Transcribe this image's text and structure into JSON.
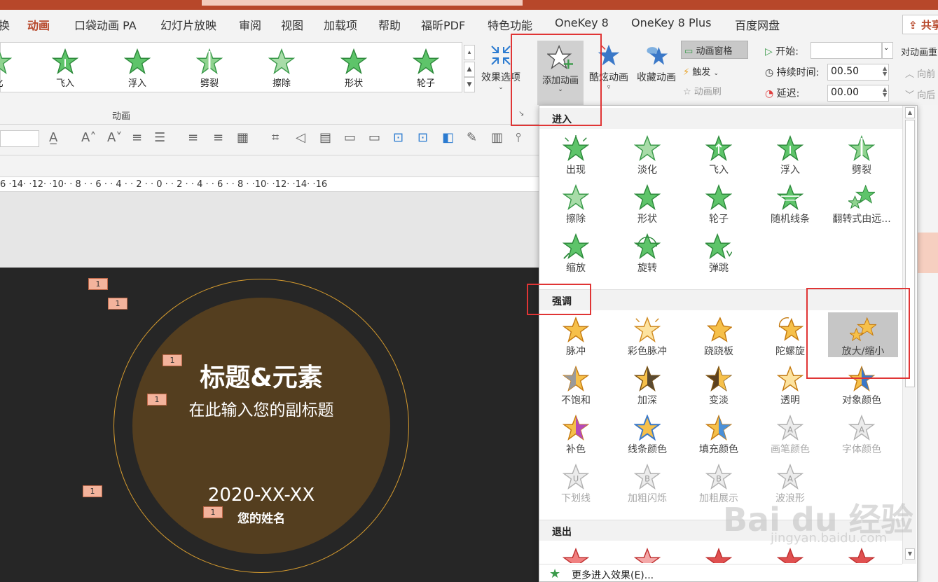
{
  "tabs": [
    "换",
    "动画",
    "口袋动画 PA",
    "幻灯片放映",
    "审阅",
    "视图",
    "加载项",
    "帮助",
    "福昕PDF",
    "特色功能",
    "OneKey 8",
    "OneKey 8 Plus",
    "百度网盘"
  ],
  "share_label": "共享",
  "gallery": {
    "items": [
      "化",
      "飞入",
      "浮入",
      "劈裂",
      "擦除",
      "形状",
      "轮子"
    ],
    "group_label": "动画"
  },
  "ribbon": {
    "effect_options": "效果选项",
    "add_animation": "添加动画",
    "cool_animation": "酷炫动画",
    "fav_animation": "收藏动画",
    "animation_pane": "动画窗格",
    "trigger": "触发",
    "animation_painter": "动画刷",
    "start_label": "开始:",
    "start_value": "",
    "duration_label": "持续时间:",
    "duration_value": "00.50",
    "delay_label": "延迟:",
    "delay_value": "00.00",
    "reorder_label": "对动画重",
    "move_earlier": "向前",
    "move_later": "向后"
  },
  "ruler_text": "6 ·14· ·12· ·10· · 8 · · 6 · · 4 · · 2 · · 0 · · 2 · · 4 · · 6 · · 8 · ·10· ·12· ·14· ·16",
  "slide": {
    "title": "标题&元素",
    "subtitle": "在此输入您的副标题",
    "date": "2020-XX-XX",
    "name": "您的姓名",
    "tag_label": "1"
  },
  "dropdown": {
    "entrance_header": "进入",
    "entrance_items": [
      "出现",
      "淡化",
      "飞入",
      "浮入",
      "劈裂",
      "擦除",
      "形状",
      "轮子",
      "随机线条",
      "翻转式由远...",
      "缩放",
      "旋转",
      "弹跳"
    ],
    "emphasis_header": "强调",
    "emphasis_items": [
      "脉冲",
      "彩色脉冲",
      "跷跷板",
      "陀螺旋",
      "放大/缩小",
      "不饱和",
      "加深",
      "变淡",
      "透明",
      "对象颜色",
      "补色",
      "线条颜色",
      "填充颜色",
      "画笔颜色",
      "字体颜色",
      "下划线",
      "加粗闪烁",
      "加粗展示",
      "波浪形"
    ],
    "exit_header": "退出",
    "more_entrance": "更多进入效果(E)..."
  },
  "watermark": {
    "main": "Bai du 经验",
    "sub": "jingyan.baidu.com"
  },
  "colors": {
    "accent": "#b7472a",
    "highlight": "#e03535",
    "entrance_star": "#4caf50",
    "emphasis_star": "#f0a020",
    "exit_star": "#e04040"
  }
}
